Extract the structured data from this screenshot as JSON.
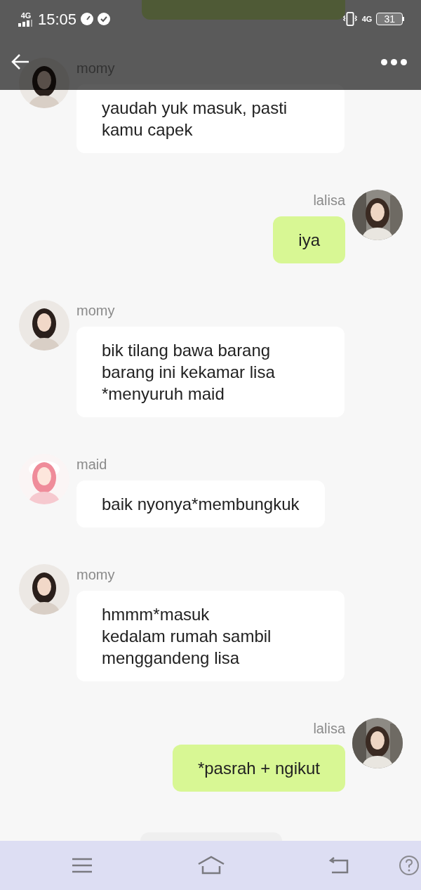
{
  "status_bar": {
    "network_left": "4G",
    "time": "15:05",
    "network_right": "4G",
    "battery": "31"
  },
  "messages": [
    {
      "outgoing": false,
      "name": "momy",
      "text": "yaudah yuk masuk, pasti kamu capek"
    },
    {
      "outgoing": true,
      "name": "lalisa",
      "kind": "street",
      "text": "iya"
    },
    {
      "outgoing": false,
      "name": "momy",
      "text": "bik tilang bawa barang barang ini kekamar lisa *menyuruh maid"
    },
    {
      "outgoing": false,
      "name": "maid",
      "kind": "anime",
      "text": "baik nyonya*membungkuk"
    },
    {
      "outgoing": false,
      "name": "momy",
      "text": "hmmm*masuk\nkedalam rumah sambil menggandeng lisa"
    },
    {
      "outgoing": true,
      "name": "lalisa",
      "kind": "street",
      "text": "*pasrah + ngikut"
    }
  ]
}
